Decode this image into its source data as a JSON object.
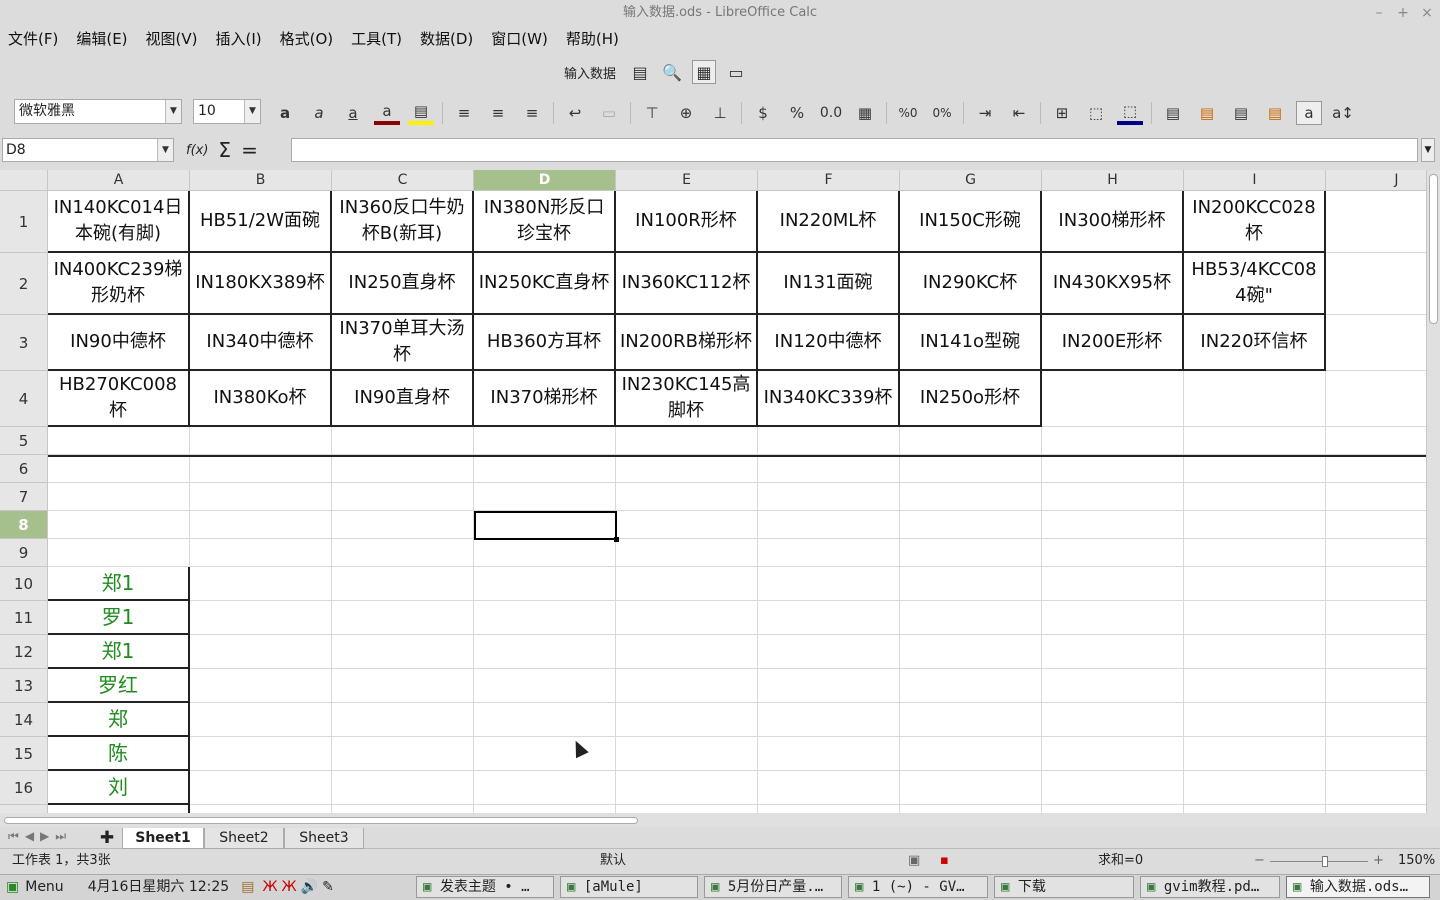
{
  "window": {
    "title": "输入数据.ods - LibreOffice Calc",
    "controls": [
      "–",
      "+",
      "×"
    ]
  },
  "menu": [
    "文件(F)",
    "编辑(E)",
    "视图(V)",
    "插入(I)",
    "格式(O)",
    "工具(T)",
    "数据(D)",
    "窗口(W)",
    "帮助(H)"
  ],
  "toolbar1": {
    "label": "输入数据"
  },
  "toolbar2": {
    "font_name": "微软雅黑",
    "font_size": "10",
    "icons": [
      "bold-icon",
      "italic-icon",
      "underline-icon",
      "font-color-icon",
      "highlight-icon",
      "align-left-icon",
      "align-center-icon",
      "align-right-icon",
      "wrap-text-icon",
      "merge-cells-icon",
      "align-top-icon",
      "align-middle-icon",
      "align-bottom-icon",
      "currency-icon",
      "percent-icon",
      "number-format-icon",
      "date-format-icon",
      "add-decimal-icon",
      "remove-decimal-icon",
      "increase-indent-icon",
      "decrease-indent-icon",
      "borders-icon",
      "border-style-icon",
      "border-color-icon",
      "conditional-format-icon"
    ],
    "font_color": "#8b0000",
    "highlight_color": "#ffef00",
    "border_color": "#00008b"
  },
  "formula_bar": {
    "name_box": "D8",
    "fx": "f(x)",
    "sum": "Σ",
    "equals": "=",
    "value": ""
  },
  "columns": [
    "A",
    "B",
    "C",
    "D",
    "E",
    "F",
    "G",
    "H",
    "I",
    "J"
  ],
  "selected_column": "D",
  "rows": [
    "1",
    "2",
    "3",
    "4",
    "5",
    "6",
    "7",
    "8",
    "9",
    "10",
    "11",
    "12",
    "13",
    "14",
    "15",
    "16"
  ],
  "selected_row": "8",
  "cells": {
    "r1": [
      "IN140KC014日本碗(有脚)",
      "HB51/2W面碗",
      "IN360反口牛奶杯B(新耳)",
      "IN380N形反口珍宝杯",
      "IN100R形杯",
      "IN220ML杯",
      "IN150C形碗",
      "IN300梯形杯",
      "IN200KCC028杯"
    ],
    "r2": [
      "IN400KC239梯形奶杯",
      "IN180KX389杯",
      "IN250直身杯",
      "IN250KC直身杯",
      "IN360KC112杯",
      "IN131面碗",
      "IN290KC杯",
      "IN430KX95杯",
      "HB53/4KCC084碗\""
    ],
    "r3": [
      "IN90中德杯",
      "IN340中德杯",
      "IN370单耳大汤杯",
      "HB360方耳杯",
      "IN200RB梯形杯",
      "IN120中德杯",
      "IN141o型碗",
      "IN200E形杯",
      "IN220环信杯"
    ],
    "r4": [
      "HB270KC008杯",
      "IN380Ko杯",
      "IN90直身杯",
      "IN370梯形杯",
      "IN230KC145高脚杯",
      "IN340KC339杯",
      "IN250o形杯"
    ]
  },
  "colA_names": [
    "郑1",
    "罗1",
    "郑1",
    "罗红",
    "郑",
    "陈",
    "刘"
  ],
  "sheets": [
    "Sheet1",
    "Sheet2",
    "Sheet3"
  ],
  "active_sheet": "Sheet1",
  "status": {
    "sheet_info": "工作表 1，共3张",
    "style": "默认",
    "sum": "求和=0",
    "zoom": "150%",
    "zoom_level": 0.55
  },
  "taskbar": {
    "menu": "Menu",
    "clock": "4月16日星期六 12:25",
    "tasks": [
      "发表主题 • …",
      "[aMule]",
      "5月份日产量.…",
      "1 (~) - GV…",
      "下载",
      "gvim教程.pd…",
      "输入数据.ods…"
    ]
  }
}
